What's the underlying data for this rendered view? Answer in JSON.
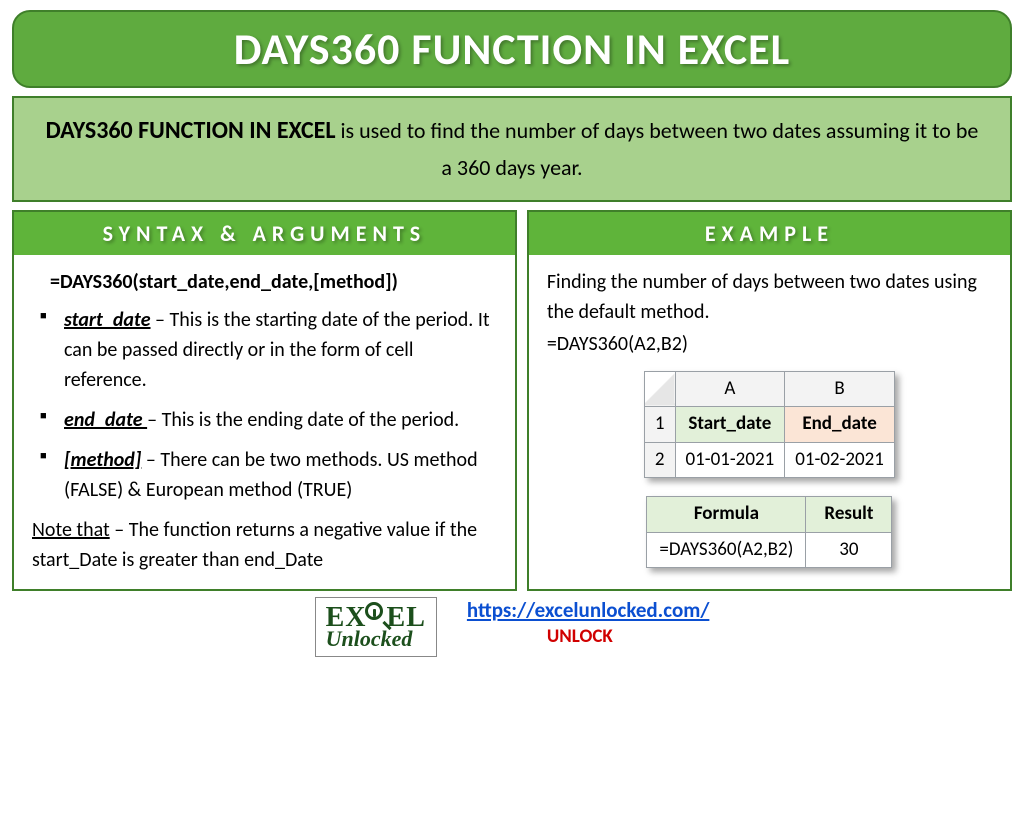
{
  "title": "DAYS360 FUNCTION IN EXCEL",
  "description": {
    "bold": "DAYS360 FUNCTION IN EXCEL",
    "rest": " is used to find the number of days between two dates assuming it to be a 360 days year."
  },
  "syntax": {
    "heading": "SYNTAX & ARGUMENTS",
    "formula": "=DAYS360(start_date,end_date,[method])",
    "args": [
      {
        "name": "start_date",
        "desc": " – This is the starting date of the period. It can be passed directly or in the form of cell reference."
      },
      {
        "name": "end_date ",
        "desc": "– This is the ending date of the period."
      },
      {
        "name": "[method]",
        "desc": " – There can be two methods. US method (FALSE) & European method (TRUE)"
      }
    ],
    "note_label": "Note that",
    "note_text": " – The function returns a negative value if the start_Date is greater than end_Date"
  },
  "example": {
    "heading": "EXAMPLE",
    "intro": "Finding the number of days between two dates using the default method.",
    "formula": "=DAYS360(A2,B2)",
    "table1": {
      "col_a": "A",
      "col_b": "B",
      "row1": "1",
      "row2": "2",
      "header_a": "Start_date",
      "header_b": "End_date",
      "val_a": "01-01-2021",
      "val_b": "01-02-2021"
    },
    "table2": {
      "h1": "Formula",
      "h2": "Result",
      "v1": "=DAYS360(A2,B2)",
      "v2": "30"
    }
  },
  "footer": {
    "logo_ex": "EX",
    "logo_el": "EL",
    "logo_unlocked": "Unlocked",
    "url": "https://excelunlocked.com/",
    "unlock": "UNLOCK"
  }
}
